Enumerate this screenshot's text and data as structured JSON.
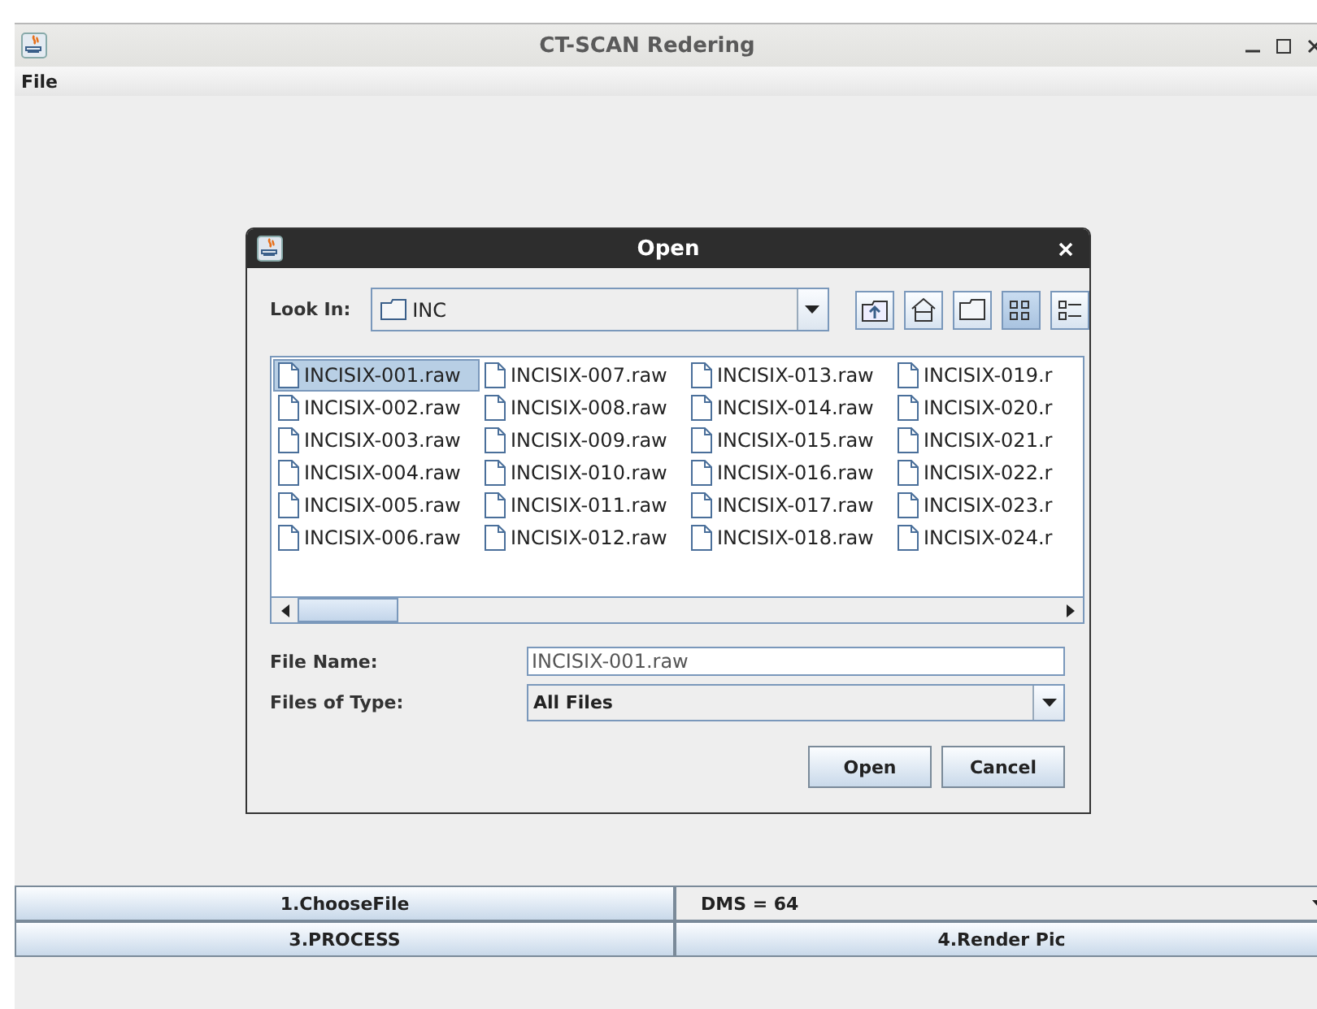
{
  "window": {
    "title": "CT-SCAN Redering"
  },
  "menu": [
    "File"
  ],
  "dialog": {
    "title": "Open",
    "look_in": {
      "label": "Look In:",
      "value": "INC"
    },
    "tools": [
      {
        "kind": "up",
        "selected": false
      },
      {
        "kind": "home",
        "selected": false
      },
      {
        "kind": "folder",
        "selected": false
      },
      {
        "kind": "list",
        "selected": true
      },
      {
        "kind": "details",
        "selected": false
      }
    ],
    "files": [
      {
        "name": "INCISIX-001.raw",
        "selected": true
      },
      {
        "name": "INCISIX-002.raw",
        "selected": false
      },
      {
        "name": "INCISIX-003.raw",
        "selected": false
      },
      {
        "name": "INCISIX-004.raw",
        "selected": false
      },
      {
        "name": "INCISIX-005.raw",
        "selected": false
      },
      {
        "name": "INCISIX-006.raw",
        "selected": false
      },
      {
        "name": "INCISIX-007.raw",
        "selected": false
      },
      {
        "name": "INCISIX-008.raw",
        "selected": false
      },
      {
        "name": "INCISIX-009.raw",
        "selected": false
      },
      {
        "name": "INCISIX-010.raw",
        "selected": false
      },
      {
        "name": "INCISIX-011.raw",
        "selected": false
      },
      {
        "name": "INCISIX-012.raw",
        "selected": false
      },
      {
        "name": "INCISIX-013.raw",
        "selected": false
      },
      {
        "name": "INCISIX-014.raw",
        "selected": false
      },
      {
        "name": "INCISIX-015.raw",
        "selected": false
      },
      {
        "name": "INCISIX-016.raw",
        "selected": false
      },
      {
        "name": "INCISIX-017.raw",
        "selected": false
      },
      {
        "name": "INCISIX-018.raw",
        "selected": false
      },
      {
        "name": "INCISIX-019.r",
        "selected": false
      },
      {
        "name": "INCISIX-020.r",
        "selected": false
      },
      {
        "name": "INCISIX-021.r",
        "selected": false
      },
      {
        "name": "INCISIX-022.r",
        "selected": false
      },
      {
        "name": "INCISIX-023.r",
        "selected": false
      },
      {
        "name": "INCISIX-024.r",
        "selected": false
      }
    ],
    "file_name": {
      "label": "File Name:",
      "value": "INCISIX-001.raw"
    },
    "file_type": {
      "label": "Files of Type:",
      "value": "All Files"
    },
    "buttons": [
      "Open",
      "Cancel"
    ]
  },
  "controls": {
    "choose": "1.ChooseFile",
    "dms": "DMS = 64",
    "process": "3.PROCESS",
    "render": "4.Render Pic"
  }
}
